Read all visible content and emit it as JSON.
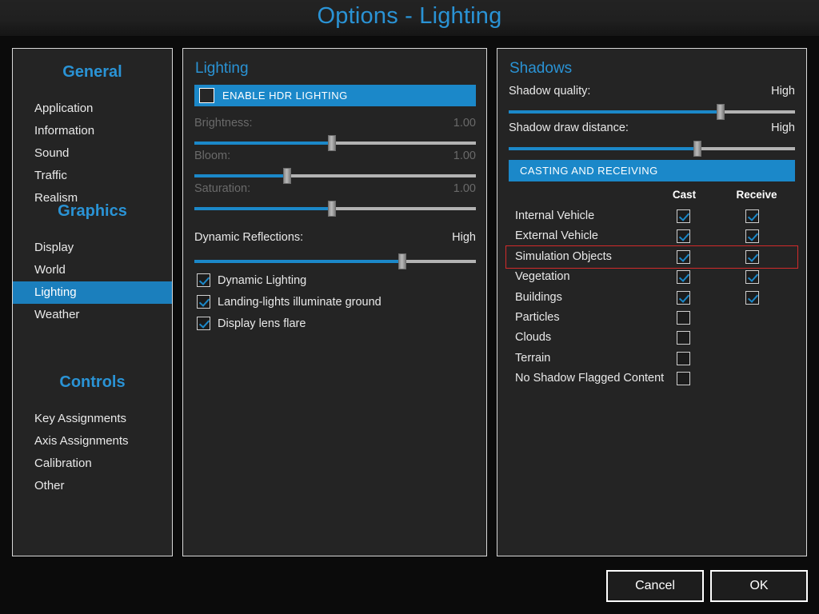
{
  "window": {
    "title": "Options - Lighting"
  },
  "accent": {
    "blue": "#1b88c9",
    "title_blue": "#2a93d5",
    "highlight_red": "#d22b2b"
  },
  "sidebar": {
    "groups": [
      {
        "title": "General",
        "items": [
          {
            "label": "Application",
            "selected": false
          },
          {
            "label": "Information",
            "selected": false
          },
          {
            "label": "Sound",
            "selected": false
          },
          {
            "label": "Traffic",
            "selected": false
          },
          {
            "label": "Realism",
            "selected": false
          }
        ]
      },
      {
        "title": "Graphics",
        "items": [
          {
            "label": "Display",
            "selected": false
          },
          {
            "label": "World",
            "selected": false
          },
          {
            "label": "Lighting",
            "selected": true
          },
          {
            "label": "Weather",
            "selected": false
          }
        ]
      },
      {
        "title": "Controls",
        "items": [
          {
            "label": "Key Assignments",
            "selected": false
          },
          {
            "label": "Axis Assignments",
            "selected": false
          },
          {
            "label": "Calibration",
            "selected": false
          },
          {
            "label": "Other",
            "selected": false
          }
        ]
      }
    ]
  },
  "lighting": {
    "heading": "Lighting",
    "hdr_banner": {
      "label": "ENABLE HDR LIGHTING",
      "checked": false
    },
    "sliders": [
      {
        "label": "Brightness:",
        "value": "1.00",
        "percent": 49,
        "disabled": true
      },
      {
        "label": "Bloom:",
        "value": "1.00",
        "percent": 33,
        "disabled": true
      },
      {
        "label": "Saturation:",
        "value": "1.00",
        "percent": 49,
        "disabled": true
      }
    ],
    "dynamic_reflections": {
      "label": "Dynamic Reflections:",
      "value": "High",
      "percent": 74,
      "disabled": false
    },
    "checkboxes": [
      {
        "label": "Dynamic Lighting",
        "checked": true
      },
      {
        "label": "Landing-lights illuminate ground",
        "checked": true
      },
      {
        "label": "Display lens flare",
        "checked": true
      }
    ]
  },
  "shadows": {
    "heading": "Shadows",
    "sliders": [
      {
        "label": "Shadow quality:",
        "value": "High",
        "percent": 74
      },
      {
        "label": "Shadow draw distance:",
        "value": "High",
        "percent": 66
      }
    ],
    "banner": {
      "label": "CASTING AND RECEIVING"
    },
    "columns": {
      "cast": "Cast",
      "receive": "Receive"
    },
    "rows": [
      {
        "label": "Internal Vehicle",
        "cast": true,
        "cast_present": true,
        "receive": true,
        "receive_present": true,
        "highlighted": false
      },
      {
        "label": "External Vehicle",
        "cast": true,
        "cast_present": true,
        "receive": true,
        "receive_present": true,
        "highlighted": false
      },
      {
        "label": "Simulation Objects",
        "cast": true,
        "cast_present": true,
        "receive": true,
        "receive_present": true,
        "highlighted": true
      },
      {
        "label": "Vegetation",
        "cast": true,
        "cast_present": true,
        "receive": true,
        "receive_present": true,
        "highlighted": false
      },
      {
        "label": "Buildings",
        "cast": true,
        "cast_present": true,
        "receive": true,
        "receive_present": true,
        "highlighted": false
      },
      {
        "label": "Particles",
        "cast": false,
        "cast_present": true,
        "receive": false,
        "receive_present": false,
        "highlighted": false
      },
      {
        "label": "Clouds",
        "cast": false,
        "cast_present": true,
        "receive": false,
        "receive_present": false,
        "highlighted": false
      },
      {
        "label": "Terrain",
        "cast": false,
        "cast_present": true,
        "receive": false,
        "receive_present": false,
        "highlighted": false
      },
      {
        "label": "No Shadow Flagged Content",
        "cast": false,
        "cast_present": true,
        "receive": false,
        "receive_present": false,
        "highlighted": false
      }
    ]
  },
  "footer": {
    "cancel": "Cancel",
    "ok": "OK"
  }
}
